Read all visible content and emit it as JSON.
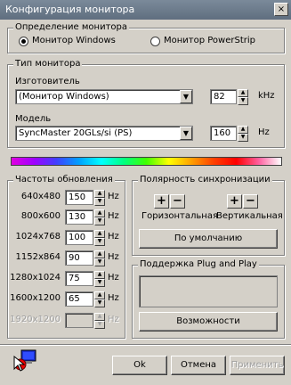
{
  "window": {
    "title": "Конфигурация монитора",
    "close": "×"
  },
  "detect": {
    "title": "Определение монитора",
    "options": [
      {
        "label": "Монитор Windows",
        "selected": true
      },
      {
        "label": "Монитор PowerStrip",
        "selected": false
      }
    ]
  },
  "monitor_type": {
    "title": "Тип монитора",
    "manufacturer_label": "Изготовитель",
    "manufacturer_value": "(Монитор Windows)",
    "model_label": "Модель",
    "model_value": "SyncMaster 20GLs/si (PS)",
    "hsync_value": "82",
    "hsync_unit": "kHz",
    "vsync_value": "160",
    "vsync_unit": "Hz"
  },
  "refresh": {
    "title": "Частоты обновления",
    "rows": [
      {
        "res": "640x480",
        "rate": "150",
        "unit": "Hz",
        "enabled": true
      },
      {
        "res": "800x600",
        "rate": "130",
        "unit": "Hz",
        "enabled": true
      },
      {
        "res": "1024x768",
        "rate": "100",
        "unit": "Hz",
        "enabled": true
      },
      {
        "res": "1152x864",
        "rate": "90",
        "unit": "Hz",
        "enabled": true
      },
      {
        "res": "1280x1024",
        "rate": "75",
        "unit": "Hz",
        "enabled": true
      },
      {
        "res": "1600x1200",
        "rate": "65",
        "unit": "Hz",
        "enabled": true
      },
      {
        "res": "1920x1200",
        "rate": "",
        "unit": "Hz",
        "enabled": false
      }
    ]
  },
  "polarity": {
    "title": "Полярность синхронизации",
    "horizontal_label": "Горизонтальная",
    "vertical_label": "Вертикальная",
    "plus": "+",
    "minus": "−",
    "default_button": "По умолчанию"
  },
  "pnp": {
    "title": "Поддержка Plug and Play",
    "capabilities_button": "Возможности"
  },
  "buttons": {
    "ok": "Ok",
    "cancel": "Отмена",
    "apply": "Применить"
  },
  "colors": {
    "face": "#d4d0c8",
    "titlebar": "#6b7a8b"
  },
  "icons": {
    "footer": "monitor-pointer-icon"
  }
}
